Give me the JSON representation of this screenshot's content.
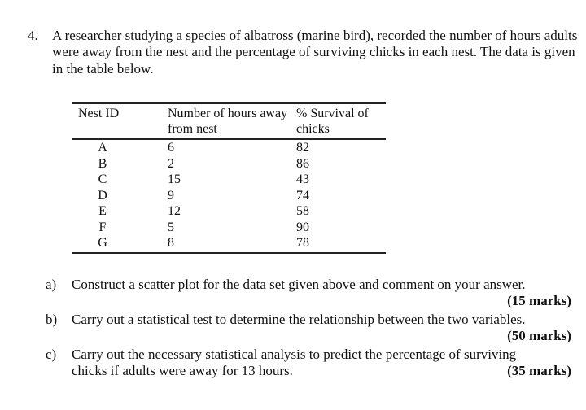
{
  "question": {
    "number": "4.",
    "text": "A researcher studying a species of albatross (marine bird), recorded the number of hours adults were away from the nest and the percentage of surviving chicks in each nest. The data is given in the table below."
  },
  "table": {
    "headers": [
      "Nest ID",
      "Number of hours away from nest",
      "% Survival of chicks"
    ],
    "rows": [
      {
        "id": "A",
        "hours": "6",
        "survival": "82"
      },
      {
        "id": "B",
        "hours": "2",
        "survival": "86"
      },
      {
        "id": "C",
        "hours": "15",
        "survival": "43"
      },
      {
        "id": "D",
        "hours": "9",
        "survival": "74"
      },
      {
        "id": "E",
        "hours": "12",
        "survival": "58"
      },
      {
        "id": "F",
        "hours": "5",
        "survival": "90"
      },
      {
        "id": "G",
        "hours": "8",
        "survival": "78"
      }
    ]
  },
  "parts": [
    {
      "label": "a)",
      "text": "Construct a scatter plot for the data set given above and comment on your answer.",
      "marks": "(15 marks)"
    },
    {
      "label": "b)",
      "text": "Carry out a statistical test to determine the relationship between the two variables.",
      "marks": "(50 marks)"
    },
    {
      "label": "c)",
      "text": "Carry out the necessary statistical analysis to predict the percentage of surviving chicks if adults were away for 13 hours.",
      "marks": "(35 marks)"
    }
  ]
}
